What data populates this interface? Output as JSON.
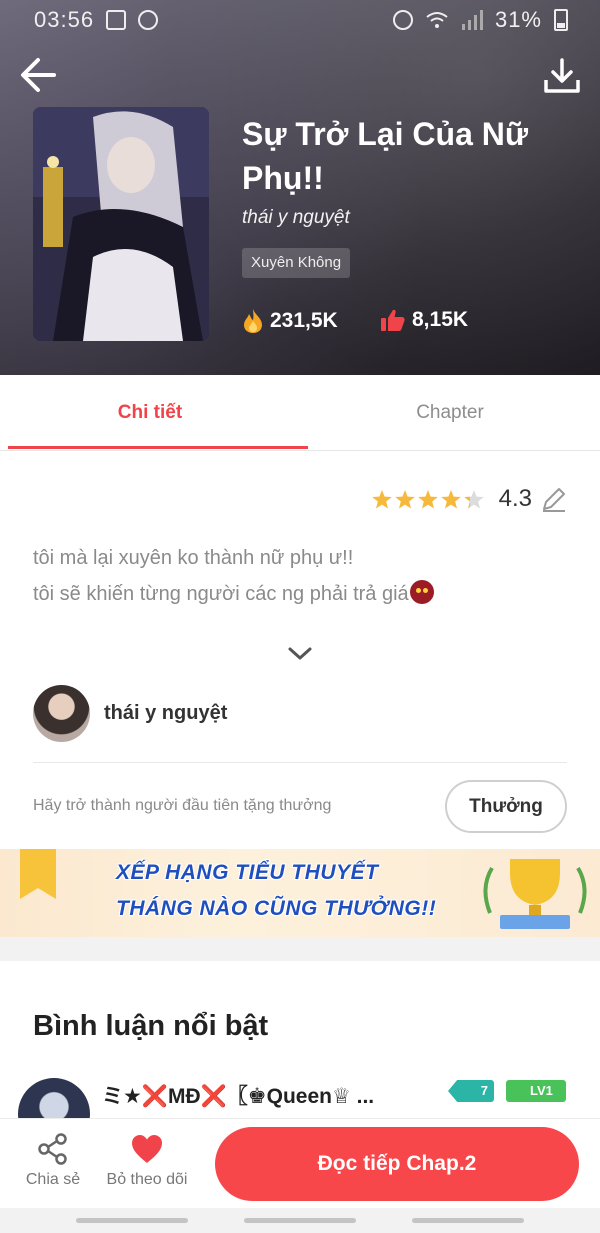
{
  "status_bar": {
    "time": "03:56",
    "battery": "31%"
  },
  "book": {
    "title": "Sự Trở Lại Của Nữ Phụ!!",
    "author": "thái y nguyệt",
    "genre": "Xuyên Không",
    "views": "231,5K",
    "likes": "8,15K"
  },
  "tabs": {
    "detail": "Chi tiết",
    "chapter": "Chapter"
  },
  "rating": {
    "value": "4.3",
    "stars": 4.3
  },
  "description": {
    "line1": "tôi mà lại xuyên ko thành nữ phụ ư!!",
    "line2": "tôi sẽ khiến từng người các ng phải trả giá"
  },
  "author_row": {
    "name": "thái y nguyệt"
  },
  "reward": {
    "text": "Hãy trở thành người đầu tiên tặng thưởng",
    "button": "Thưởng"
  },
  "banner": {
    "line1": "XẾP HẠNG TIỂU THUYẾT",
    "line2": "THÁNG NÀO CŨNG THƯỞNG!!"
  },
  "comments": {
    "section_title": "Bình luận nổi bật",
    "first": {
      "name": "ミ★❌MĐ❌〖♚Queen♕ ...",
      "badge1": "7",
      "badge2": "LV1"
    }
  },
  "bottom_bar": {
    "share": "Chia sẻ",
    "unfollow": "Bỏ theo dõi",
    "read": "Đọc tiếp Chap.2"
  },
  "colors": {
    "accent": "#f0444a",
    "button": "#f8474b",
    "star": "#f6b93b"
  }
}
